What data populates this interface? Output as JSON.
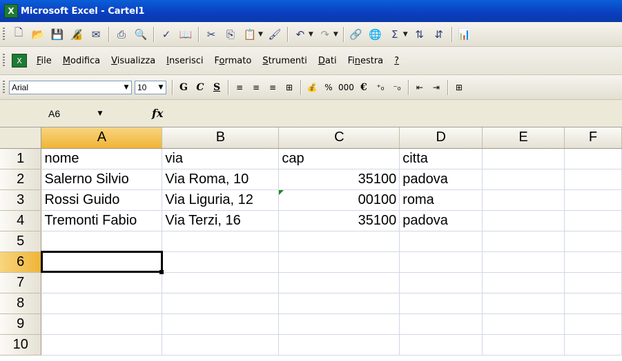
{
  "window": {
    "title": "Microsoft Excel - Cartel1",
    "app_icon": "X"
  },
  "menu": {
    "items": [
      {
        "pre": "",
        "u": "F",
        "post": "ile"
      },
      {
        "pre": "",
        "u": "M",
        "post": "odifica"
      },
      {
        "pre": "",
        "u": "V",
        "post": "isualizza"
      },
      {
        "pre": "",
        "u": "I",
        "post": "nserisci"
      },
      {
        "pre": "F",
        "u": "o",
        "post": "rmato"
      },
      {
        "pre": "",
        "u": "S",
        "post": "trumenti"
      },
      {
        "pre": "",
        "u": "D",
        "post": "ati"
      },
      {
        "pre": "Fi",
        "u": "n",
        "post": "estra"
      },
      {
        "pre": "",
        "u": "?",
        "post": ""
      }
    ]
  },
  "formatting": {
    "font": "Arial",
    "size": "10",
    "bold": "G",
    "italic": "C",
    "underline": "S",
    "percent": "%",
    "thousands": "000",
    "euro": "€"
  },
  "formula_bar": {
    "name_box": "A6",
    "fx": "fx",
    "formula": ""
  },
  "grid": {
    "columns": [
      "A",
      "B",
      "C",
      "D",
      "E",
      "F"
    ],
    "rows": [
      {
        "n": "1",
        "A": "nome",
        "B": "via",
        "C": "cap",
        "D": "citta"
      },
      {
        "n": "2",
        "A": "Salerno Silvio",
        "B": "Via Roma, 10",
        "C": "35100",
        "D": "padova"
      },
      {
        "n": "3",
        "A": "Rossi Guido",
        "B": "Via Liguria, 12",
        "C": "00100",
        "D": "roma"
      },
      {
        "n": "4",
        "A": "Tremonti Fabio",
        "B": "Via Terzi, 16",
        "C": "35100",
        "D": "padova"
      },
      {
        "n": "5"
      },
      {
        "n": "6"
      },
      {
        "n": "7"
      },
      {
        "n": "8"
      },
      {
        "n": "9"
      },
      {
        "n": "10"
      }
    ],
    "active_cell": "A6"
  },
  "colors": {
    "title_bar": "#0a46c8",
    "header_selected": "#f0b437",
    "toolbar": "#ece9d8"
  }
}
